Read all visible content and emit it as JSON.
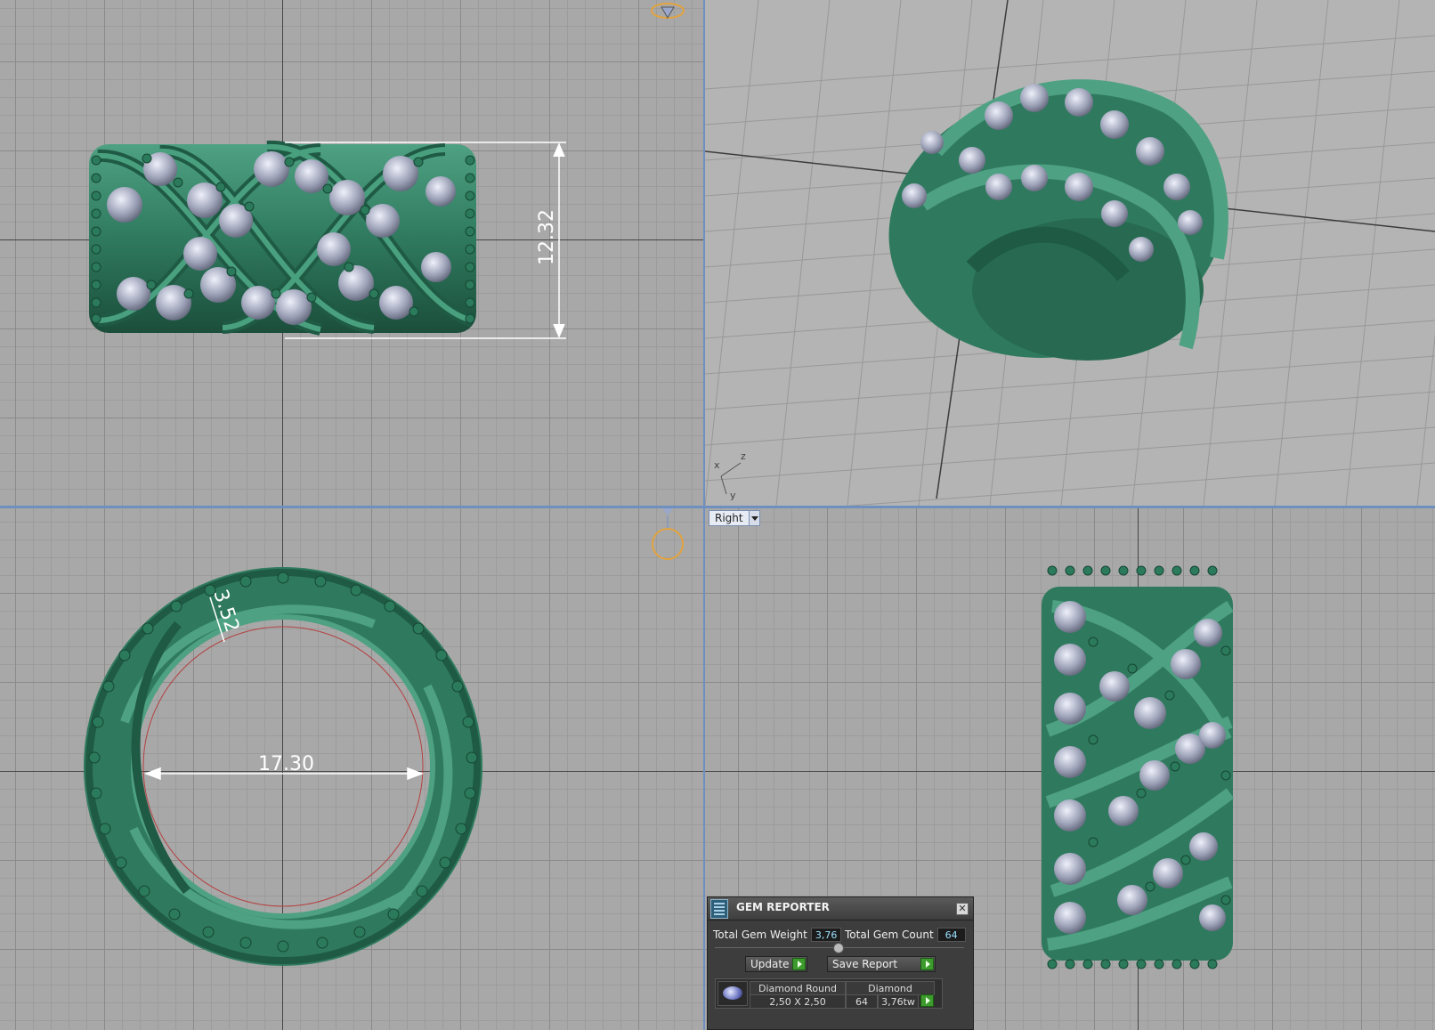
{
  "viewports": {
    "top": {
      "dimension_label": "12.32"
    },
    "front": {
      "diameter_label": "17.30",
      "thickness_label": "3.52"
    },
    "perspective": {
      "axis_labels": [
        "x",
        "z",
        "y"
      ]
    },
    "right": {
      "view_menu_label": "Right"
    }
  },
  "gem_reporter": {
    "title": "GEM REPORTER",
    "total_gem_weight_label": "Total Gem Weight",
    "total_gem_weight_value": "3,76",
    "total_gem_count_label": "Total Gem Count",
    "total_gem_count_value": "64",
    "update_label": "Update",
    "save_report_label": "Save Report",
    "table": {
      "shape": "Diamond Round",
      "size": "2,50 X 2,50",
      "material": "Diamond",
      "count": "64",
      "weight": "3,76tw"
    }
  },
  "colors": {
    "metal": "#2f7a5e",
    "stone": "#b9bccb",
    "grid_background": "#a8a8a8",
    "viewport_divider": "#6f8fbf"
  },
  "icons": {
    "view_cube_top": "ring-gem-orientation-icon",
    "view_cube_front": "ring-orientation-icon",
    "panel_app": "gem-reporter-icon",
    "close": "close-icon",
    "play": "play-icon",
    "gem_thumb": "diamond-round-icon"
  }
}
